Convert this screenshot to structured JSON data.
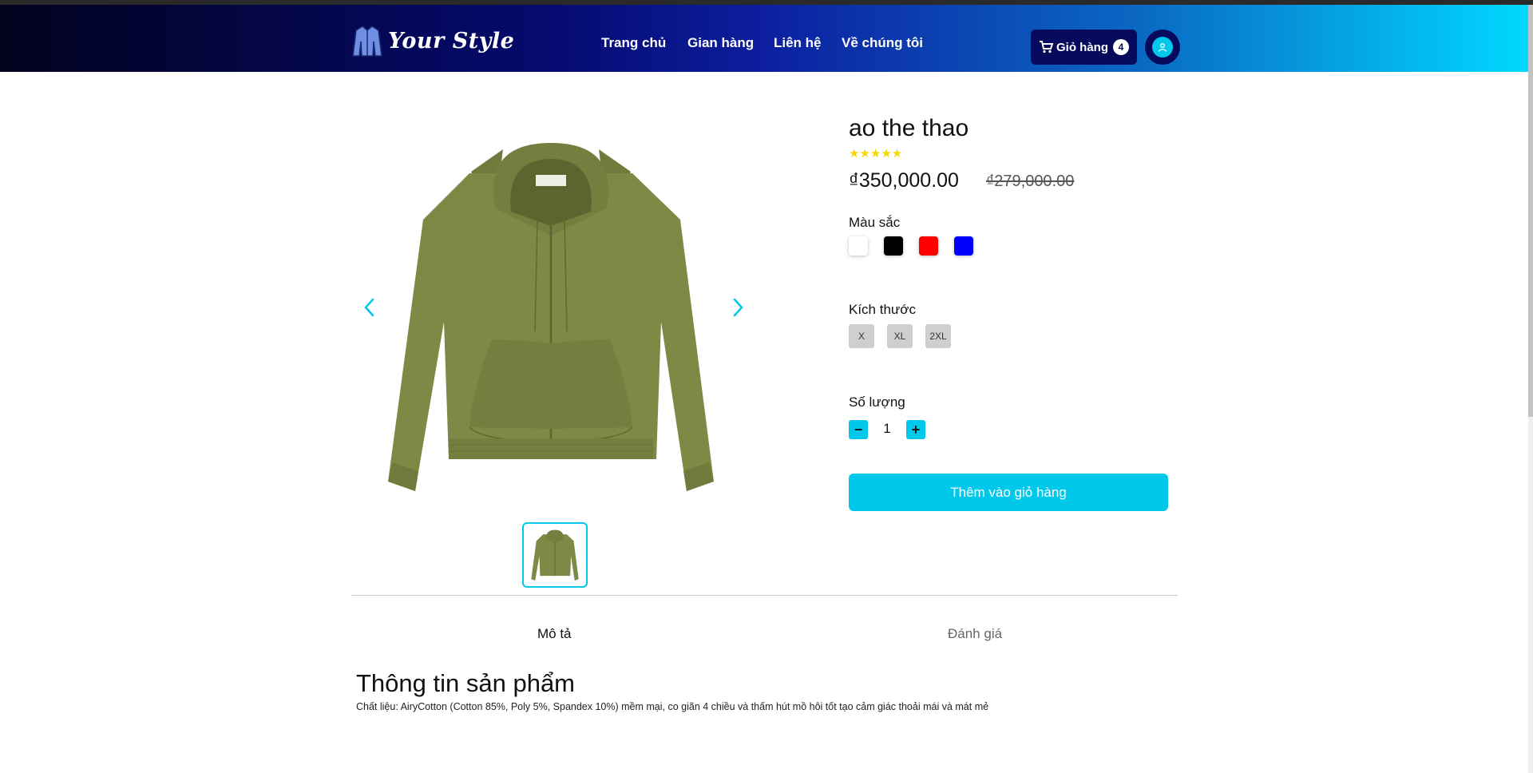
{
  "header": {
    "logo_text": "Your Style",
    "nav": [
      "Trang chủ",
      "Gian hàng",
      "Liên hệ",
      "Về chúng tôi"
    ],
    "cart_label": "Giỏ hàng",
    "cart_count": "4"
  },
  "product": {
    "name": "ao the thao",
    "rating": "★★★★★",
    "price": "₫350,000.00",
    "old_price": "₫279,000.00",
    "color_label": "Màu sắc",
    "colors": [
      "#ffffff",
      "#000000",
      "#ff0000",
      "#0000ff"
    ],
    "size_label": "Kích thước",
    "sizes": [
      "X",
      "XL",
      "2XL"
    ],
    "quantity_label": "Số lượng",
    "quantity": "1",
    "add_to_cart": "Thêm vào giỏ hàng"
  },
  "tabs": [
    "Mô tả",
    "Đánh giá"
  ],
  "description": {
    "title": "Thông tin sản phẩm",
    "text": "Chất liệu: AiryCotton (Cotton 85%, Poly 5%, Spandex 10%) mềm mại, co giãn 4 chiều và thấm hút mồ hôi tốt tạo cảm giác thoải mái và mát mẻ"
  },
  "colors": {
    "accent": "#00c8ea",
    "navy": "#060a5c",
    "jacket": "#7c8a45"
  }
}
